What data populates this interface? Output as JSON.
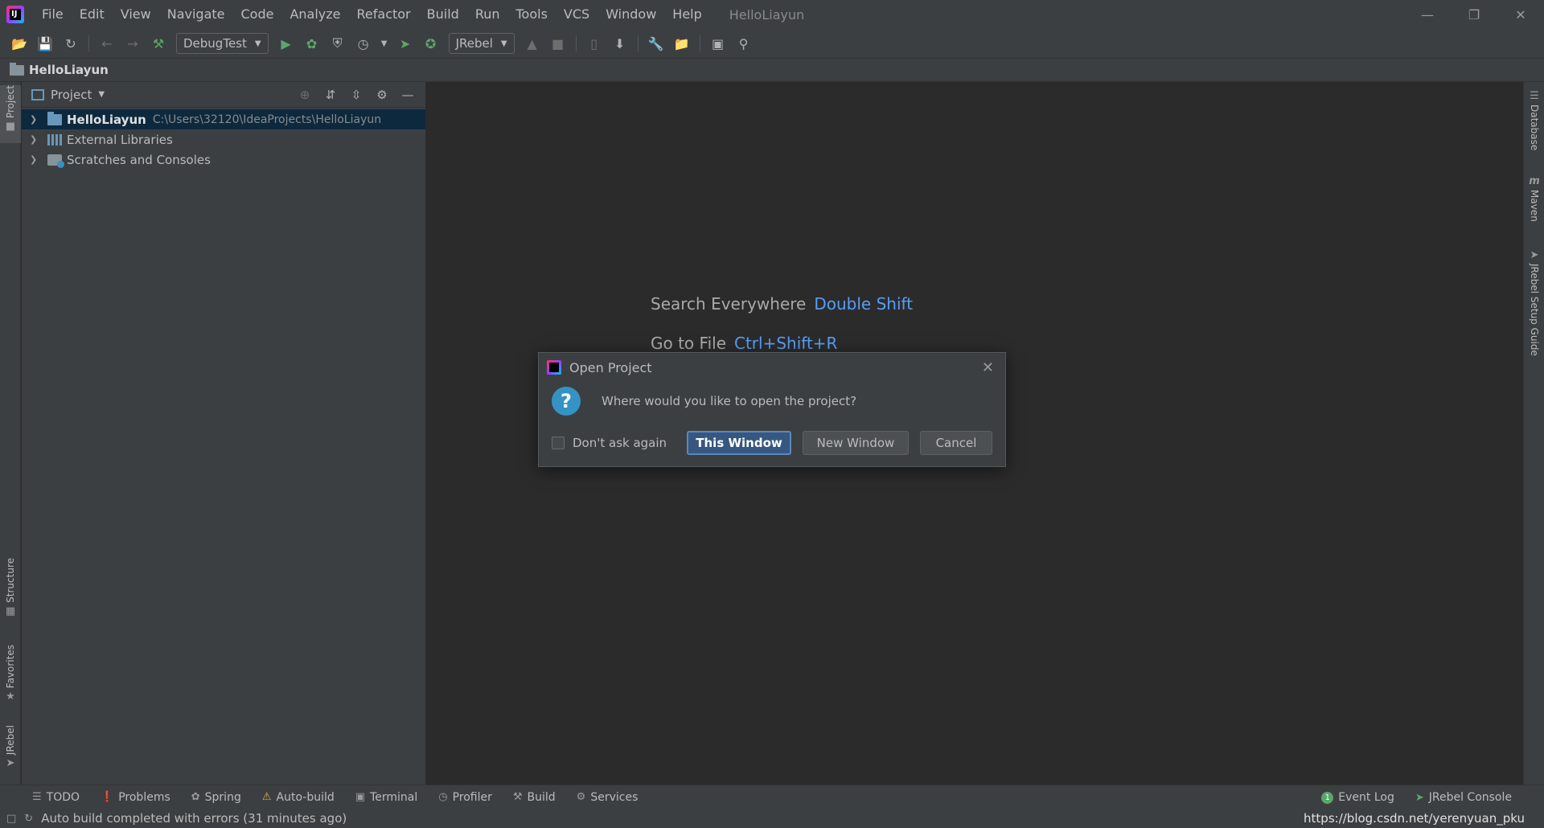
{
  "app": {
    "menu": [
      "File",
      "Edit",
      "View",
      "Navigate",
      "Code",
      "Analyze",
      "Refactor",
      "Build",
      "Run",
      "Tools",
      "VCS",
      "Window",
      "Help"
    ],
    "title": "HelloLiayun"
  },
  "toolbar": {
    "run_config": "DebugTest",
    "jrebel_combo": "JRebel"
  },
  "navbar": {
    "crumb": "HelloLiayun"
  },
  "left_strip": {
    "project": "Project",
    "structure": "Structure",
    "favorites": "Favorites",
    "jrebel": "JRebel"
  },
  "right_strip": {
    "database": "Database",
    "maven": "Maven",
    "jrebel_guide": "JRebel Setup Guide"
  },
  "project_panel": {
    "title": "Project",
    "tree": [
      {
        "label": "HelloLiayun",
        "path": "C:\\Users\\32120\\IdeaProjects\\HelloLiayun"
      },
      {
        "label": "External Libraries"
      },
      {
        "label": "Scratches and Consoles"
      }
    ]
  },
  "editor": {
    "hints": [
      {
        "label": "Search Everywhere",
        "key": "Double Shift"
      },
      {
        "label": "Go to File",
        "key": "Ctrl+Shift+R"
      }
    ]
  },
  "dialog": {
    "title": "Open Project",
    "message": "Where would you like to open the project?",
    "checkbox_label": "Don't ask again",
    "buttons": {
      "this_window": "This Window",
      "new_window": "New Window",
      "cancel": "Cancel"
    }
  },
  "bottom_tools": {
    "todo": "TODO",
    "problems": "Problems",
    "spring": "Spring",
    "auto_build": "Auto-build",
    "terminal": "Terminal",
    "profiler": "Profiler",
    "build": "Build",
    "services": "Services",
    "event_log": "Event Log",
    "event_log_count": "1",
    "jrebel_console": "JRebel Console"
  },
  "status": {
    "message": "Auto build completed with errors (31 minutes ago)",
    "watermark": "https://blog.csdn.net/yerenyuan_pku"
  },
  "colors": {
    "accent": "#589df6",
    "selection": "#0d293e",
    "primary_button": "#365880"
  }
}
